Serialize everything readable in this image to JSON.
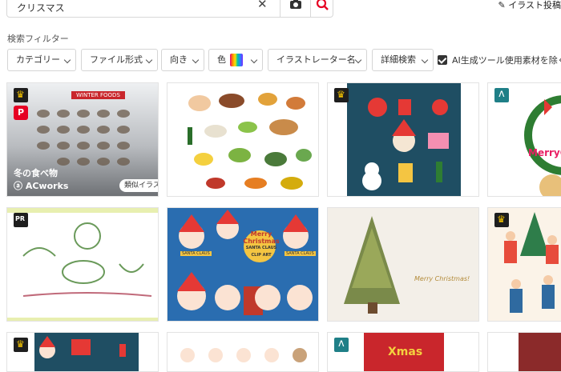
{
  "search": {
    "query": "クリスマス"
  },
  "header": {
    "post_link": "イラスト投稿"
  },
  "filters": {
    "title": "検索フィルター",
    "category": "カテゴリー",
    "file_format": "ファイル形式",
    "orientation": "向き",
    "color": "色",
    "illustrator": "イラストレーター名",
    "detail": "詳細検索",
    "exclude_ai": "AI生成ツール使用素材を除く"
  },
  "cards": {
    "winter_food": {
      "ribbon": "WINTER FOODS",
      "title": "冬の食べ物",
      "brand": "ACworks",
      "similar": "類似イラスト ›"
    },
    "card8_text": "MerryCh",
    "card5_texts": [
      "Merry",
      "Christmas",
      "SANTA CLAUS",
      "CLIP ART",
      "SANTA CLAUS",
      "SANTA CLAUS"
    ],
    "card6_text": "Merry Christmas!",
    "card10_text": "Xmas"
  },
  "colors": {
    "accent": "#e60023",
    "premium": "#f2c200",
    "teal_bg": "#1f4e63"
  }
}
